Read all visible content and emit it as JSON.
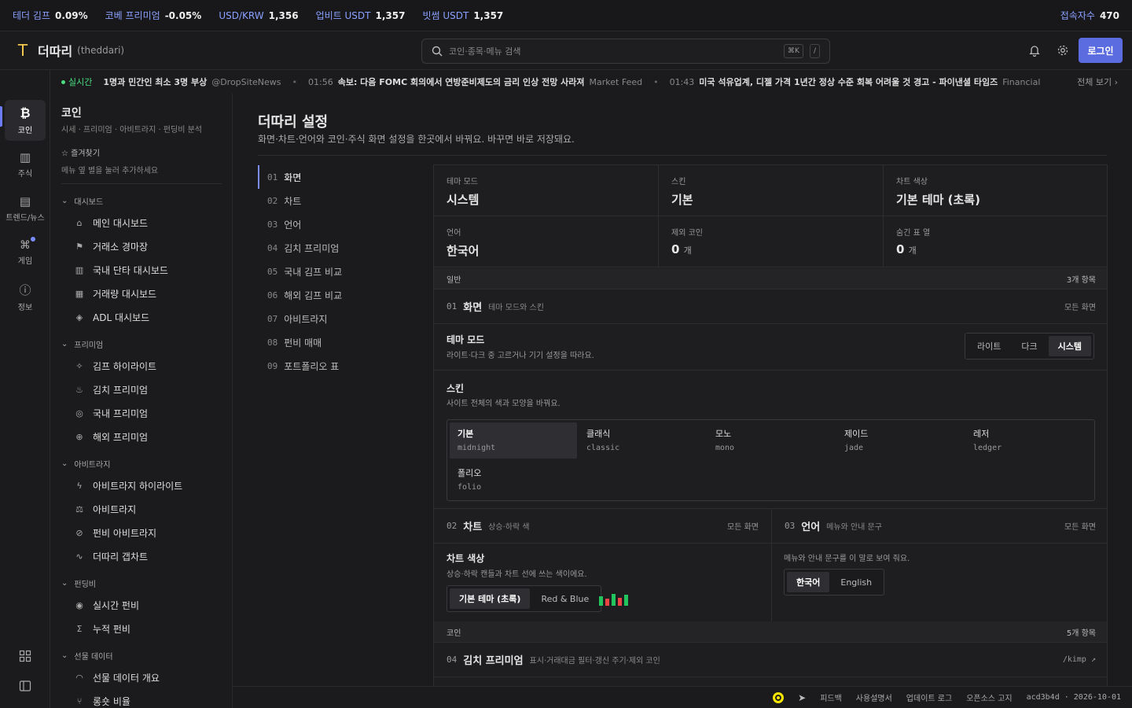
{
  "topbar": {
    "items": [
      {
        "label": "테더 김프",
        "value": "0.09%"
      },
      {
        "label": "코베 프리미엄",
        "value": "-0.05%"
      },
      {
        "label": "USD/KRW",
        "value": "1,356"
      },
      {
        "label": "업비트 USDT",
        "value": "1,357"
      },
      {
        "label": "빗썸 USDT",
        "value": "1,357"
      }
    ],
    "visitors_label": "접속자수",
    "visitors_value": "470"
  },
  "header": {
    "logo": "T",
    "brand": "더따리",
    "brand_sub": "(theddari)",
    "search_placeholder": "코인·종목·메뉴 검색",
    "kbd1": "⌘K",
    "kbd2": "/",
    "login": "로그인"
  },
  "ticker": {
    "live": "실시간",
    "news": [
      {
        "time": "",
        "text": "1명과 민간인 최소 3명 부상",
        "src": "@DropSiteNews"
      },
      {
        "time": "01:56",
        "text": "속보: 다음 FOMC 회의에서 연방준비제도의 금리 인상 전망 사라져",
        "src": "Market Feed"
      },
      {
        "time": "01:43",
        "text": "미국 석유업계, 디젤 가격 1년간 정상 수준 회복 어려울 것 경고 - 파이낸셜 타임즈",
        "src": "Financial"
      }
    ],
    "more": "전체 보기 ›"
  },
  "rail": [
    {
      "label": "코인",
      "icon": "bitcoin-icon",
      "glyph": "₿"
    },
    {
      "label": "주식",
      "icon": "chart-icon",
      "glyph": "▥"
    },
    {
      "label": "트렌드/뉴스",
      "icon": "newspaper-icon",
      "glyph": "▤"
    },
    {
      "label": "게임",
      "icon": "gamepad-icon",
      "glyph": "⌘"
    },
    {
      "label": "정보",
      "icon": "info-icon",
      "glyph": "ⓘ"
    }
  ],
  "sidebar": {
    "title": "코인",
    "subtitle": "시세 · 프리미엄 · 아비트라지 · 펀딩비 분석",
    "fav": "☆ 즐겨찾기",
    "fav_sub": "메뉴 옆 별을 눌러 추가하세요",
    "groups": [
      {
        "label": "대시보드",
        "items": [
          {
            "label": "메인 대시보드",
            "glyph": "⌂"
          },
          {
            "label": "거래소 경마장",
            "glyph": "⚑"
          },
          {
            "label": "국내 단타 대시보드",
            "glyph": "▥"
          },
          {
            "label": "거래량 대시보드",
            "glyph": "▦"
          },
          {
            "label": "ADL 대시보드",
            "glyph": "◈"
          }
        ]
      },
      {
        "label": "프리미엄",
        "items": [
          {
            "label": "김프 하이라이트",
            "glyph": "✧"
          },
          {
            "label": "김치 프리미엄",
            "glyph": "♨"
          },
          {
            "label": "국내 프리미엄",
            "glyph": "◎"
          },
          {
            "label": "해외 프리미엄",
            "glyph": "⊕"
          }
        ]
      },
      {
        "label": "아비트라지",
        "items": [
          {
            "label": "아비트라지 하이라이트",
            "glyph": "ϟ"
          },
          {
            "label": "아비트라지",
            "glyph": "⚖"
          },
          {
            "label": "펀비 아비트라지",
            "glyph": "⊘"
          },
          {
            "label": "더따리 갭차트",
            "glyph": "∿"
          }
        ]
      },
      {
        "label": "펀딩비",
        "items": [
          {
            "label": "실시간 펀비",
            "glyph": "◉"
          },
          {
            "label": "누적 펀비",
            "glyph": "Σ"
          }
        ]
      },
      {
        "label": "선물 데이터",
        "items": [
          {
            "label": "선물 데이터 개요",
            "glyph": "◠"
          },
          {
            "label": "롱숏 비율",
            "glyph": "⑂"
          }
        ]
      }
    ]
  },
  "page": {
    "title": "더따리 설정",
    "subtitle": "화면·차트·언어와 코인·주식 화면 설정을 한곳에서 바꿔요. 바꾸면 바로 저장돼요.",
    "toc": [
      {
        "num": "01",
        "label": "화면"
      },
      {
        "num": "02",
        "label": "차트"
      },
      {
        "num": "03",
        "label": "언어"
      },
      {
        "num": "04",
        "label": "김치 프리미엄"
      },
      {
        "num": "05",
        "label": "국내 김프 비교"
      },
      {
        "num": "06",
        "label": "해외 김프 비교"
      },
      {
        "num": "07",
        "label": "아비트라지"
      },
      {
        "num": "08",
        "label": "펀비 매매"
      },
      {
        "num": "09",
        "label": "포트폴리오 표"
      }
    ]
  },
  "summary": [
    {
      "label": "테마 모드",
      "value": "시스템",
      "unit": ""
    },
    {
      "label": "스킨",
      "value": "기본",
      "unit": ""
    },
    {
      "label": "차트 색상",
      "value": "기본 테마 (초록)",
      "unit": ""
    },
    {
      "label": "언어",
      "value": "한국어",
      "unit": ""
    },
    {
      "label": "제외 코인",
      "value": "0",
      "unit": "개"
    },
    {
      "label": "숨긴 표 열",
      "value": "0",
      "unit": "개"
    }
  ],
  "general": {
    "label": "일반",
    "count": "3개 항목"
  },
  "screen": {
    "num": "01",
    "title": "화면",
    "desc": "테마 모드와 스킨",
    "scope": "모든 화면",
    "theme_title": "테마 모드",
    "theme_desc": "라이트·다크 중 고르거나 기기 설정을 따라요.",
    "theme_options": [
      "라이트",
      "다크",
      "시스템"
    ],
    "skin_title": "스킨",
    "skin_desc": "사이트 전체의 색과 모양을 바꿔요.",
    "skins": [
      {
        "name": "기본",
        "code": "midnight"
      },
      {
        "name": "클래식",
        "code": "classic"
      },
      {
        "name": "모노",
        "code": "mono"
      },
      {
        "name": "제이드",
        "code": "jade"
      },
      {
        "name": "레저",
        "code": "ledger"
      },
      {
        "name": "폴리오",
        "code": "folio"
      }
    ]
  },
  "chart": {
    "num": "02",
    "title": "차트",
    "desc": "상승·하락 색",
    "scope": "모든 화면",
    "color_title": "차트 색상",
    "color_desc": "상승·하락 캔들과 차트 선에 쓰는 색이에요.",
    "options": [
      "기본 테마 (초록)",
      "Red & Blue"
    ],
    "up_color": "#22c55e",
    "down_color": "#ef4444"
  },
  "language": {
    "num": "03",
    "title": "언어",
    "desc": "메뉴와 안내 문구",
    "scope": "모든 화면",
    "hint": "메뉴와 안내 문구를 이 말로 보여 줘요.",
    "options": [
      "한국어",
      "English"
    ]
  },
  "coin": {
    "label": "코인",
    "count": "5개 항목"
  },
  "kimp": {
    "num": "04",
    "title": "김치 프리미엄",
    "desc": "표시·거래대금 필터·갱신 주기·제외 코인",
    "link": "/kimp ↗"
  },
  "footer": {
    "items": [
      "피드백",
      "사용설명서",
      "업데이트 로그",
      "오픈소스 고지"
    ],
    "version": "acd3b4d · 2026-10-01"
  }
}
